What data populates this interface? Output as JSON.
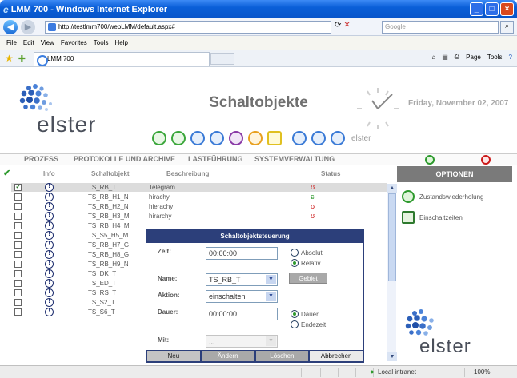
{
  "window": {
    "title": "LMM 700 - Windows Internet Explorer"
  },
  "address": {
    "url": "http://testlmm700/webLMM/default.aspx#",
    "search_placeholder": "Google"
  },
  "menu": [
    "File",
    "Edit",
    "View",
    "Favorites",
    "Tools",
    "Help"
  ],
  "tab": {
    "label": "LMM 700"
  },
  "command_bar": {
    "page": "Page",
    "tools": "Tools"
  },
  "header": {
    "logo_text": "elster",
    "title": "Schaltobjekte",
    "date": "Friday, November 02, 2007",
    "toolbar_label": "elster"
  },
  "nav": [
    "PROZESS",
    "PROTOKOLLE UND ARCHIVE",
    "LASTFÜHRUNG",
    "SYSTEMVERWALTUNG"
  ],
  "table": {
    "headers": {
      "info": "Info",
      "object": "Schaltobjekt",
      "desc": "Beschreibung",
      "status": "Status"
    },
    "rows": [
      {
        "name": "TS_RB_T",
        "desc": "Telegram",
        "status": "red",
        "checked": true
      },
      {
        "name": "TS_RB_H1_N",
        "desc": "hirachy",
        "status": "green",
        "checked": false
      },
      {
        "name": "TS_RB_H2_N",
        "desc": "hierachy",
        "status": "red",
        "checked": false
      },
      {
        "name": "TS_RB_H3_M",
        "desc": "hirarchy",
        "status": "red",
        "checked": false
      },
      {
        "name": "TS_RB_H4_M",
        "desc": "",
        "status": "",
        "checked": false
      },
      {
        "name": "TS_S5_H5_M",
        "desc": "",
        "status": "",
        "checked": false
      },
      {
        "name": "TS_RB_H7_G",
        "desc": "",
        "status": "",
        "checked": false
      },
      {
        "name": "TS_RB_H8_G",
        "desc": "",
        "status": "",
        "checked": false
      },
      {
        "name": "TS_RB_H9_N",
        "desc": "",
        "status": "",
        "checked": false
      },
      {
        "name": "TS_DK_T",
        "desc": "",
        "status": "",
        "checked": false
      },
      {
        "name": "TS_ED_T",
        "desc": "",
        "status": "",
        "checked": false
      },
      {
        "name": "TS_RS_T",
        "desc": "",
        "status": "",
        "checked": false
      },
      {
        "name": "TS_S2_T",
        "desc": "",
        "status": "",
        "checked": false
      },
      {
        "name": "TS_S6_T",
        "desc": "",
        "status": "",
        "checked": false
      }
    ]
  },
  "options": {
    "title": "OPTIONEN",
    "items": [
      "Zustandswiederholung",
      "Einschaltzeiten"
    ]
  },
  "dialog": {
    "title": "Schaltobjektsteuerung",
    "zeit_label": "Zeit:",
    "zeit_value": "00:00:00",
    "absolut": "Absolut",
    "relativ": "Relativ",
    "name_label": "Name:",
    "name_value": "TS_RB_T",
    "gebiet": "Gebiet",
    "aktion_label": "Aktion:",
    "aktion_value": "einschalten",
    "dauer_label": "Dauer:",
    "dauer_value": "00:00:00",
    "dauer_radio": "Dauer",
    "endezeit": "Endezeit",
    "mit_label": "Mit:",
    "mit_value": "...",
    "buttons": {
      "neu": "Neu",
      "aendern": "Ändern",
      "loeschen": "Löschen",
      "abbrechen": "Abbrechen"
    }
  },
  "status": {
    "zone": "Local intranet",
    "zoom": "100%"
  }
}
